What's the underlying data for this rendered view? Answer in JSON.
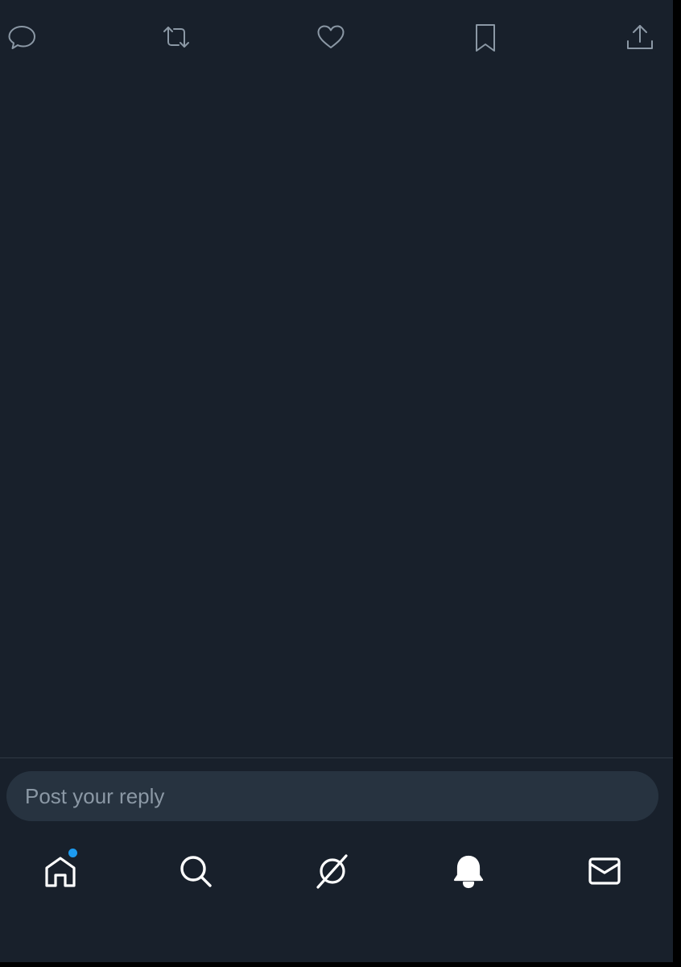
{
  "reply": {
    "placeholder": "Post your reply"
  },
  "actions": [
    {
      "name": "reply",
      "icon": "speech-bubble-icon"
    },
    {
      "name": "repost",
      "icon": "repost-arrows-icon"
    },
    {
      "name": "like",
      "icon": "heart-icon"
    },
    {
      "name": "bookmark",
      "icon": "bookmark-icon"
    },
    {
      "name": "share",
      "icon": "share-upload-icon"
    }
  ],
  "tabs": [
    {
      "name": "home",
      "icon": "house-icon",
      "active": true,
      "has_notification_dot": true
    },
    {
      "name": "search",
      "icon": "magnifier-icon",
      "active": false
    },
    {
      "name": "grok",
      "icon": "grok-slash-icon",
      "active": false
    },
    {
      "name": "notifications",
      "icon": "bell-icon",
      "active": false
    },
    {
      "name": "messages",
      "icon": "envelope-icon",
      "active": false
    }
  ],
  "colors": {
    "background": "#18202b",
    "action_icon": "#8b98a5",
    "tab_icon": "#ffffff",
    "reply_box": "#273340",
    "placeholder": "#8b98a5",
    "divider": "#2f3944",
    "notification_dot": "#1d9bf0"
  }
}
